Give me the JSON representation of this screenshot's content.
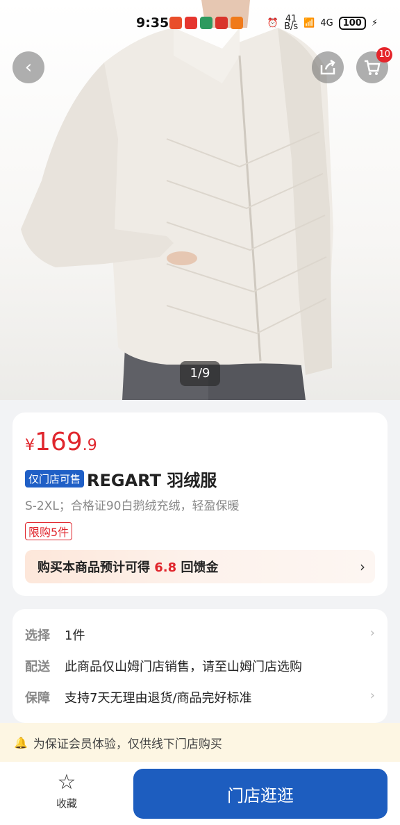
{
  "status_bar": {
    "time": "9:35",
    "network_speed": "41",
    "network_unit": "B/s",
    "signal": "6",
    "network_type": "4G",
    "battery": "100"
  },
  "header": {
    "back_icon": "chevron-left-icon",
    "share_icon": "share-icon",
    "cart_icon": "cart-icon",
    "cart_count": "10"
  },
  "gallery": {
    "pager": "1/9"
  },
  "product": {
    "price_currency": "¥",
    "price_int": "169",
    "price_dec": ".9",
    "store_tag": "仅门店可售",
    "title": "REGART 羽绒服",
    "subtitle": "S-2XL；合格证90白鹅绒充绒，轻盈保暖",
    "limit_tag": "限购5件",
    "rebate_prefix": "购买本商品预计可得",
    "rebate_amount": "6.8",
    "rebate_suffix": "回馈金"
  },
  "options": {
    "rows": [
      {
        "label": "选择",
        "value": "1件"
      },
      {
        "label": "配送",
        "value": "此商品仅山姆门店销售，请至山姆门店选购"
      },
      {
        "label": "保障",
        "value": "支持7天无理由退货/商品完好标准"
      }
    ]
  },
  "notice": {
    "text": "为保证会员体验，仅供线下门店购买"
  },
  "bottom_bar": {
    "favorite_label": "收藏",
    "store_button": "门店逛逛"
  },
  "colors": {
    "accent_blue": "#1d5dbf",
    "price_red": "#e0262d"
  }
}
